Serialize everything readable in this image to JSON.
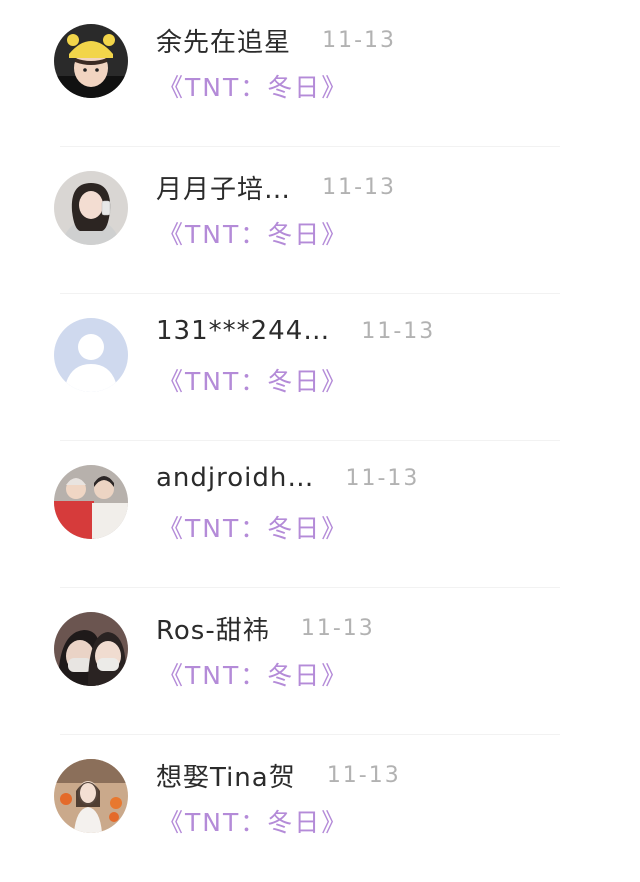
{
  "comments": [
    {
      "name": "余先在追星",
      "date": "11-13",
      "work": "《TNT：冬日》",
      "avatar": "avatar-child-yellow-hat"
    },
    {
      "name": "月月子培…",
      "date": "11-13",
      "work": "《TNT：冬日》",
      "avatar": "avatar-girl-mirror-selfie"
    },
    {
      "name": "131***244…",
      "date": "11-13",
      "work": "《TNT：冬日》",
      "avatar": "avatar-default-placeholder"
    },
    {
      "name": "andjroidh…",
      "date": "11-13",
      "work": "《TNT：冬日》",
      "avatar": "avatar-two-people-red"
    },
    {
      "name": "Ros-甜祎",
      "date": "11-13",
      "work": "《TNT：冬日》",
      "avatar": "avatar-masked-selfie"
    },
    {
      "name": "想娶Tina贺",
      "date": "11-13",
      "work": "《TNT：冬日》",
      "avatar": "avatar-girl-orange-shop"
    }
  ]
}
